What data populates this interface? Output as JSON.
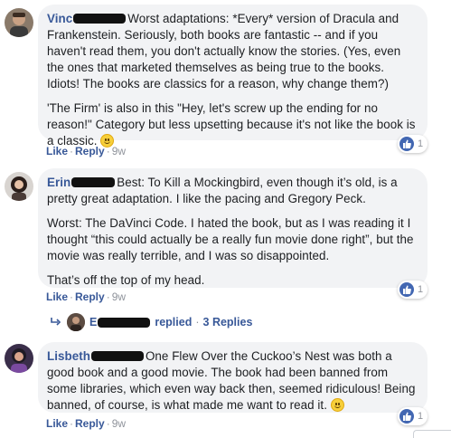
{
  "comments": [
    {
      "author": "Vinc",
      "paragraphs": [
        "Worst adaptations: *Every* version of Dracula and Frankenstein. Seriously, both books are fantastic -- and if you haven't read them, you don't actually know the stories. (Yes, even the ones that marketed themselves as being true to the books. Idiots! The books are classics for a reason, why change them?)",
        "'The Firm' is also in this \"Hey, let's screw up the ending for no reason!\" Category but less upsetting because it's not like the book is a classic."
      ],
      "like_label": "Like",
      "reply_label": "Reply",
      "time": "9w",
      "reaction_count": "1"
    },
    {
      "author": "Erin",
      "paragraphs": [
        "Best: To Kill a Mockingbird, even though it’s old, is a pretty great adaptation. I like the pacing and Gregory Peck.",
        "Worst: The DaVinci Code. I hated the book, but as I was reading it I thought “this could actually be a really fun movie done right”, but the movie was really terrible, and I was so disappointed.",
        "That’s off the top of my head."
      ],
      "like_label": "Like",
      "reply_label": "Reply",
      "time": "9w",
      "reaction_count": "1",
      "replies": {
        "author_initial": "E",
        "verb": "replied",
        "count_label": "3 Replies"
      }
    },
    {
      "author": "Lisbeth",
      "paragraphs": [
        "One Flew Over the Cuckoo’s Nest was both a good book and a good movie. The book had been banned from some libraries, which even way back then, seemed ridiculous! Being banned, of course, is what made me want to read it."
      ],
      "like_label": "Like",
      "reply_label": "Reply",
      "time": "9w",
      "reaction_count": "1"
    }
  ],
  "colors": {
    "link": "#385898",
    "bubble": "#f2f3f5",
    "meta": "#90949c",
    "like_badge": "#4267b2"
  },
  "icons": {
    "reaction": "thumbs-up-icon",
    "smile": "smile-emoji-icon",
    "wink": "wink-emoji-icon",
    "reply_arrow": "reply-arrow-icon"
  }
}
